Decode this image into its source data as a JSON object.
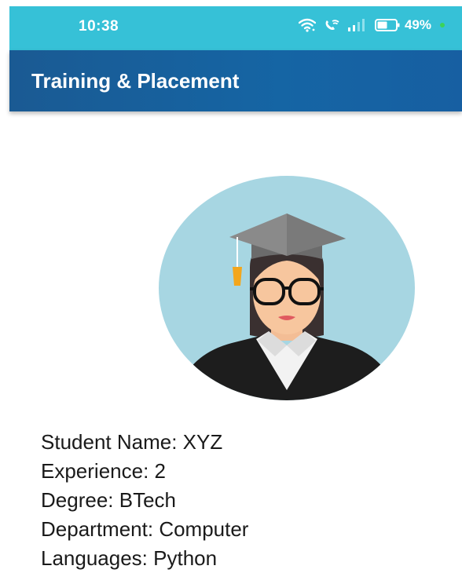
{
  "status_bar": {
    "time": "10:38",
    "battery_percent": "49%",
    "icons": [
      "wifi-icon",
      "wifi-call-icon",
      "signal-icon",
      "battery-icon"
    ]
  },
  "app_bar": {
    "title": "Training & Placement"
  },
  "profile": {
    "avatar": "graduate-avatar",
    "fields": [
      {
        "label": "Student Name:",
        "value": "XYZ"
      },
      {
        "label": "Experience:",
        "value": "2"
      },
      {
        "label": "Degree:",
        "value": "BTech"
      },
      {
        "label": "Department:",
        "value": "Computer"
      },
      {
        "label": "Languages:",
        "value": "Python"
      }
    ]
  },
  "colors": {
    "status_bar": "#36c1d7",
    "app_bar": "#1565a4",
    "avatar_bg": "#a7d6e2"
  }
}
